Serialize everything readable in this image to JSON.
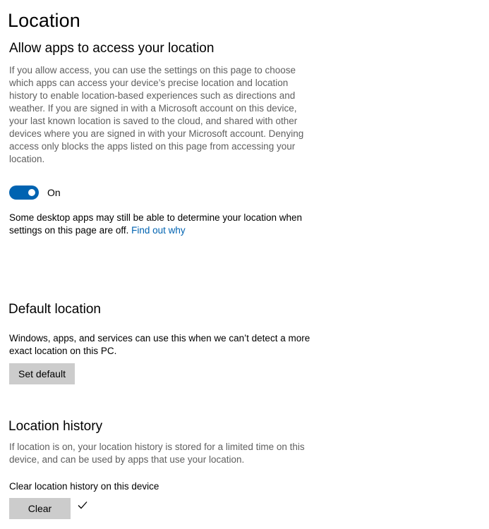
{
  "page": {
    "title": "Location"
  },
  "allow_access": {
    "heading": "Allow apps to access your location",
    "description": "If you allow access, you can use the settings on this page to choose which apps can access your device’s precise location and location history to enable location-based experiences such as directions and weather. If you are signed in with a Microsoft account on this device, your last known location is saved to the cloud, and shared with other devices where you are signed in with your Microsoft account. Denying access only blocks the apps listed on this page from accessing your location.",
    "toggle_state": "On",
    "desktop_note": "Some desktop apps may still be able to determine your location when settings on this page are off.",
    "find_out_link": "Find out why"
  },
  "default_location": {
    "heading": "Default location",
    "description": "Windows, apps, and services can use this when we can’t detect a more exact location on this PC.",
    "button_label": "Set default"
  },
  "location_history": {
    "heading": "Location history",
    "description": "If location is on, your location history is stored for a limited time on this device, and can be used by apps that use your location.",
    "clear_label": "Clear location history on this device",
    "button_label": "Clear",
    "status_icon": "checkmark-icon"
  },
  "colors": {
    "accent": "#0063b1",
    "button_bg": "#cccccc",
    "muted_text": "#5f5f5f"
  }
}
